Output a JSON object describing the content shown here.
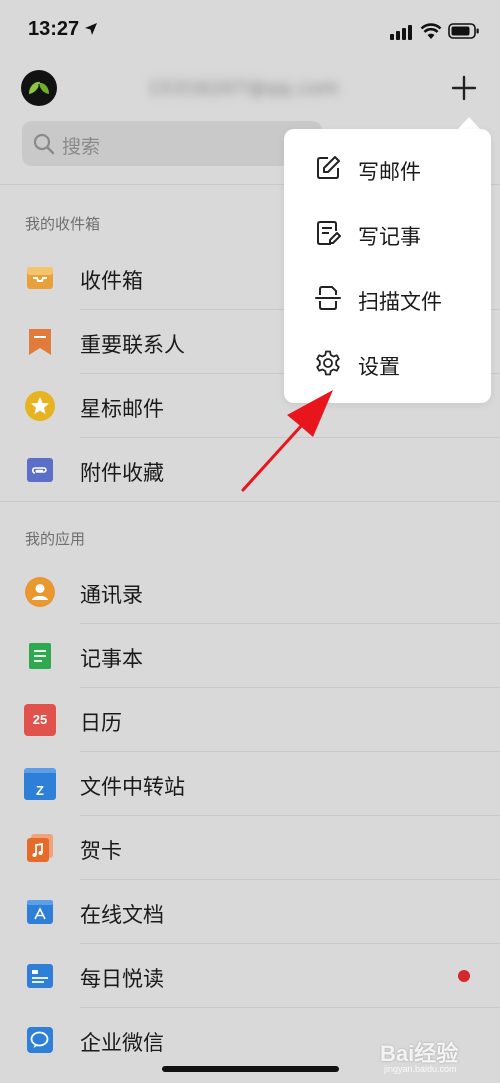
{
  "status_bar": {
    "time": "13:27"
  },
  "header": {
    "account": "15316207@qq.com",
    "plus_icon": "plus-icon"
  },
  "search": {
    "placeholder": "搜索"
  },
  "sections": {
    "inbox_title": "我的收件箱",
    "apps_title": "我的应用"
  },
  "inbox_items": [
    {
      "label": "收件箱",
      "icon": "inbox-icon",
      "color": "#e8a13a"
    },
    {
      "label": "重要联系人",
      "icon": "bookmark-icon",
      "color": "#e07b3c"
    },
    {
      "label": "星标邮件",
      "icon": "star-icon",
      "color": "#e7b321"
    },
    {
      "label": "附件收藏",
      "icon": "attachment-icon",
      "color": "#5b6fc7"
    }
  ],
  "app_items": [
    {
      "label": "通讯录",
      "icon": "contacts-icon",
      "color": "#e8982e"
    },
    {
      "label": "记事本",
      "icon": "notebook-icon",
      "color": "#2fa84f"
    },
    {
      "label": "日历",
      "icon": "calendar-icon",
      "color": "#e0524b",
      "badge_text": "25"
    },
    {
      "label": "文件中转站",
      "icon": "folder-icon",
      "color": "#2e7fd8",
      "badge_text": "Z"
    },
    {
      "label": "贺卡",
      "icon": "card-icon",
      "color": "#e46b2a"
    },
    {
      "label": "在线文档",
      "icon": "document-icon",
      "color": "#2e7fd8"
    },
    {
      "label": "每日悦读",
      "icon": "reading-icon",
      "color": "#2e7fd8",
      "unread_dot": true
    },
    {
      "label": "企业微信",
      "icon": "wecom-icon",
      "color": "#2e7fd8"
    }
  ],
  "popup_menu": {
    "items": [
      {
        "label": "写邮件",
        "icon": "compose-icon"
      },
      {
        "label": "写记事",
        "icon": "note-icon"
      },
      {
        "label": "扫描文件",
        "icon": "scan-icon"
      },
      {
        "label": "设置",
        "icon": "settings-icon"
      }
    ]
  },
  "colors": {
    "accent_red": "#d8262f",
    "background": "#d9d9d9",
    "popup_bg": "#ffffff"
  },
  "watermark": {
    "text": "Bai经验",
    "sub": "jingyan.baidu.com"
  }
}
